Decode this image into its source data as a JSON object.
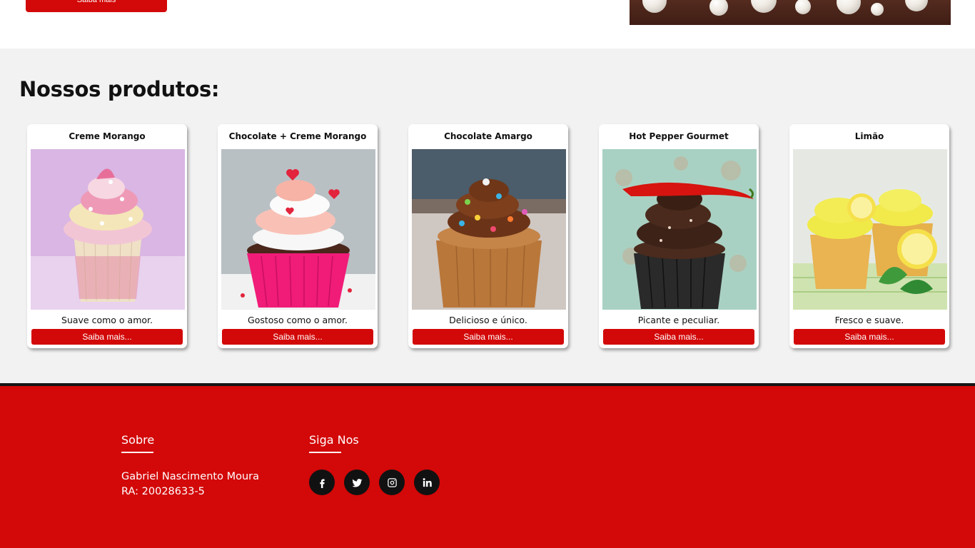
{
  "hero": {
    "button_label": "Saiba mais"
  },
  "products": {
    "title": "Nossos produtos:",
    "items": [
      {
        "name": "Creme Morango",
        "description": "Suave como o amor.",
        "button_label": "Saiba mais..."
      },
      {
        "name": "Chocolate + Creme Morango",
        "description": "Gostoso como o amor.",
        "button_label": "Saiba mais..."
      },
      {
        "name": "Chocolate Amargo",
        "description": "Delicioso e único.",
        "button_label": "Saiba mais..."
      },
      {
        "name": "Hot Pepper Gourmet",
        "description": "Picante e peculiar.",
        "button_label": "Saiba mais..."
      },
      {
        "name": "Limão",
        "description": "Fresco e suave.",
        "button_label": "Saiba mais..."
      }
    ]
  },
  "footer": {
    "about": {
      "title": "Sobre",
      "name": "Gabriel Nascimento Moura",
      "ra": "RA: 20028633-5"
    },
    "follow": {
      "title": "Siga Nos",
      "icons": [
        "facebook-icon",
        "twitter-icon",
        "instagram-icon",
        "linkedin-icon"
      ]
    }
  },
  "colors": {
    "accent": "#d30808",
    "section_bg": "#f2f2f2",
    "dark": "#111111"
  }
}
